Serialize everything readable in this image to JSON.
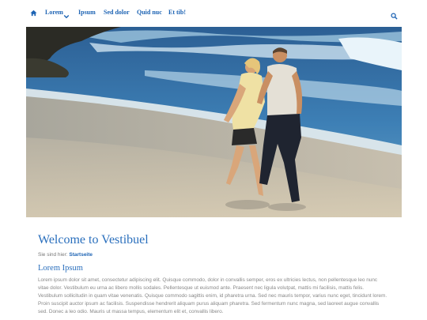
{
  "nav": {
    "items": [
      {
        "label": "Lorem"
      },
      {
        "label": "Ipsum"
      },
      {
        "label": "Sed dolor"
      },
      {
        "label": "Quid nuc"
      },
      {
        "label": "Et tib!"
      }
    ],
    "home_icon": "home-icon",
    "search_icon": "search-icon",
    "dropdown_icon": "chevron-down-icon"
  },
  "hero": {
    "alt": "Couple walking barefoot along the beach in the surf"
  },
  "content": {
    "title": "Welcome to Vestibuel",
    "breadcrumb_prefix": "Sie sind hier:",
    "breadcrumb_link": "Startseite",
    "section_title": "Lorem Ipsum",
    "paragraph": "Lorem ipsum dolor sit amet, consectetur adipiscing elit. Quisque commodo, dolor in convallis semper, eros ex ultricies lectus, non pellentesque leo nunc vitae dolor. Vestibulum eu urna ac libero mollis sodales. Pellentesque ut euismod ante. Praesent nec ligula volutpat, mattis mi facilisis, mattis felis. Vestibulum sollicitudin in quam vitae venenatis. Quisque commodo sagittis enim, id pharetra urna. Sed nec mauris tempor, varius nunc eget, tincidunt lorem. Proin suscipit auctor ipsum ac facilisis. Suspendisse hendrerit aliquam purus aliquam pharetra. Sed fermentum nunc magna, sed laoreet augue convallis sed. Donec a leo odio. Mauris ut massa tempus, elementum elit et, convallis libero."
  },
  "colors": {
    "link": "#1e64b4",
    "heading": "#2a6fbd",
    "text": "#888888"
  }
}
